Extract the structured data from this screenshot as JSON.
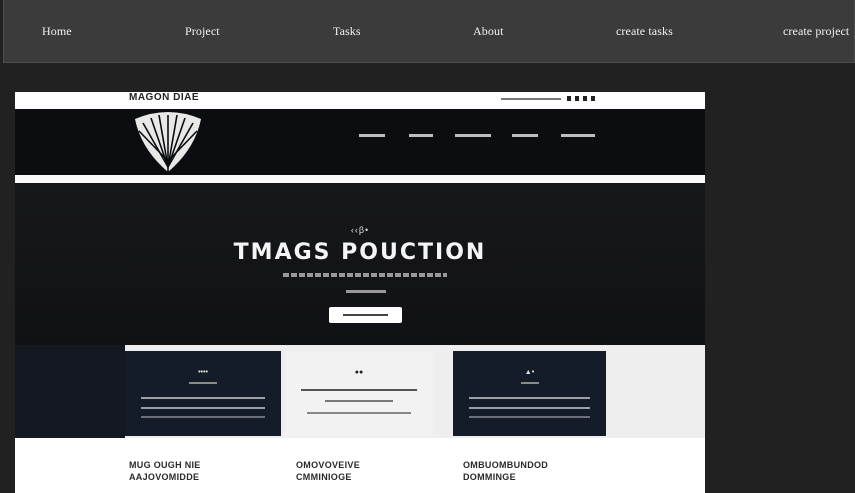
{
  "nav": {
    "items": [
      {
        "label": "Home"
      },
      {
        "label": "Project"
      },
      {
        "label": "Tasks"
      },
      {
        "label": "About"
      },
      {
        "label": "create tasks"
      },
      {
        "label": "create project"
      }
    ]
  },
  "image": {
    "brand": "MAGON DIAE",
    "hero_small": "‹‹β•",
    "hero_title": "TMAGS POUCTION",
    "cards": [
      {
        "title": "••••"
      },
      {
        "title": "●●"
      },
      {
        "title": "▲•"
      }
    ],
    "bottom": [
      {
        "line1": "MUG OUGH NIE",
        "line2": "AAJOVOMIDDE"
      },
      {
        "line1": "OMOVOVEIVE",
        "line2": "CMMINIOGE"
      },
      {
        "line1": "OMBUOMBUNDOD",
        "line2": "DOMMINGE"
      }
    ]
  },
  "colors": {
    "page_bg": "#212121",
    "navbar_bg": "#3b3b3b",
    "nav_text": "#f2f2f2"
  }
}
